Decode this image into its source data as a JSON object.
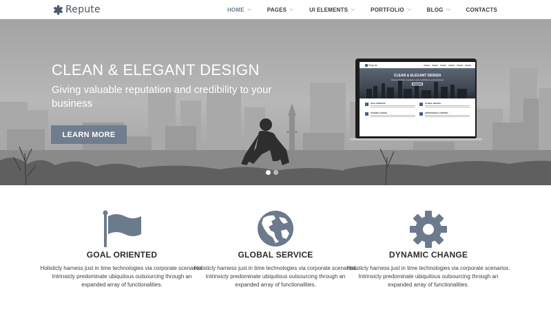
{
  "brand": {
    "name": "Repute"
  },
  "nav": {
    "items": [
      {
        "label": "HOME",
        "active": true,
        "dropdown": true
      },
      {
        "label": "PAGES",
        "active": false,
        "dropdown": true
      },
      {
        "label": "UI ELEMENTS",
        "active": false,
        "dropdown": true
      },
      {
        "label": "PORTFOLIO",
        "active": false,
        "dropdown": true
      },
      {
        "label": "BLOG",
        "active": false,
        "dropdown": true
      },
      {
        "label": "CONTACTS",
        "active": false,
        "dropdown": false
      }
    ]
  },
  "hero": {
    "title": "CLEAN & ELEGANT DESIGN",
    "subtitle": "Giving valuable reputation and credibility to your business",
    "button_label": "LEARN MORE",
    "slides": 2,
    "active_slide": 1,
    "preview": {
      "brand": "Repute",
      "title": "CLEAN & ELEGANT DESIGN",
      "subtitle": "Giving valuable reputation and credibility to your business",
      "cards": [
        "GOAL ORIENTED",
        "GLOBAL SERVICE",
        "DYNAMIC CHANGE",
        "PROFESSIONAL SUPPORT"
      ]
    }
  },
  "features": [
    {
      "icon": "flag-icon",
      "title": "GOAL ORIENTED",
      "description": "Holisticly harness just in time technologies via corporate scenarios. Intrinsicly predominate ubiquitous outsourcing through an expanded array of functionalities."
    },
    {
      "icon": "globe-icon",
      "title": "GLOBAL SERVICE",
      "description": "Holisticly harness just in time technologies via corporate scenarios. Intrinsicly predominate ubiquitous outsourcing through an expanded array of functionalities."
    },
    {
      "icon": "gear-icon",
      "title": "DYNAMIC CHANGE",
      "description": "Holisticly harness just in time technologies via corporate scenarios. Intrinsicly predominate ubiquitous outsourcing through an expanded array of functionalities."
    }
  ],
  "colors": {
    "accent": "#6f7d8f",
    "icon": "#6b7a8d",
    "nav_active": "#6b7e96",
    "text_dark": "#2b2b2b"
  }
}
